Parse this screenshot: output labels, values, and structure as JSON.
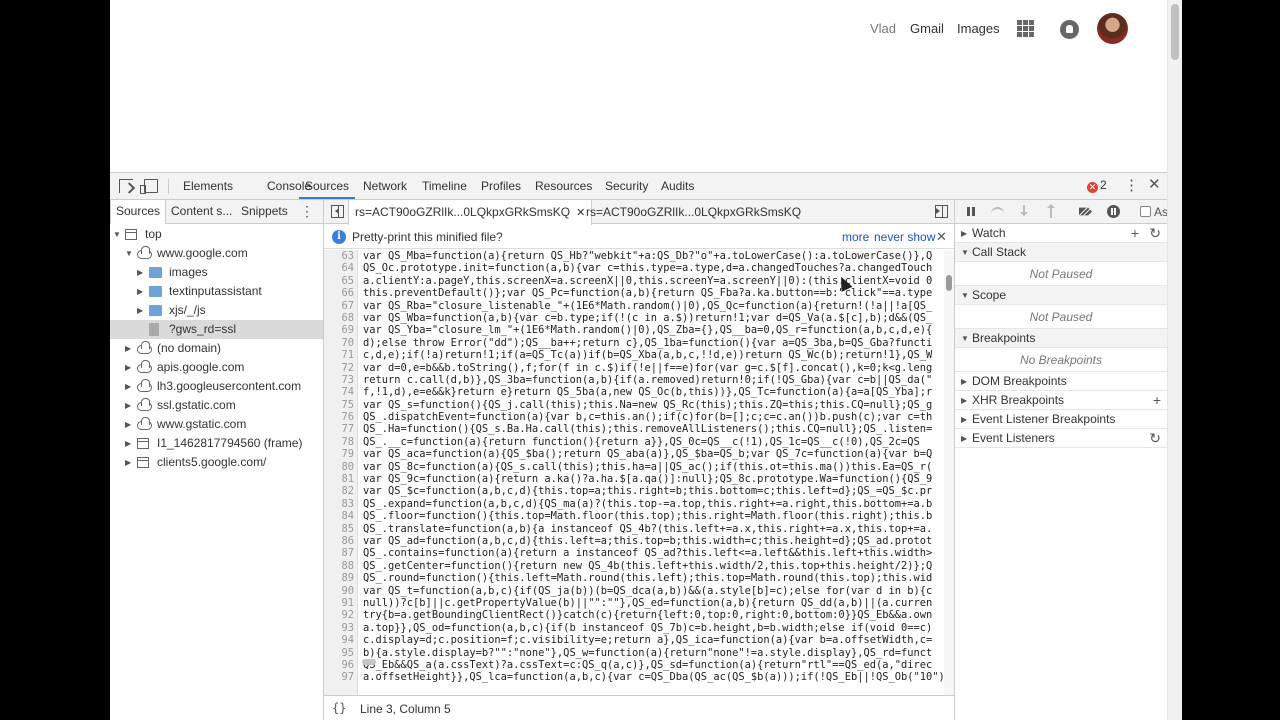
{
  "google_bar": {
    "user": "Vlad",
    "gmail": "Gmail",
    "images": "Images"
  },
  "devtools": {
    "tabs": [
      "Elements",
      "Console",
      "Sources",
      "Network",
      "Timeline",
      "Profiles",
      "Resources",
      "Security",
      "Audits"
    ],
    "active_tab": "Sources",
    "error_count": "2"
  },
  "navigator": {
    "tabs": [
      "Sources",
      "Content s...",
      "Snippets"
    ],
    "tree": [
      {
        "label": "top",
        "indent": 0,
        "arrow": "▼",
        "icon": "frame"
      },
      {
        "label": "www.google.com",
        "indent": 1,
        "arrow": "▼",
        "icon": "cloud"
      },
      {
        "label": "images",
        "indent": 2,
        "arrow": "▶",
        "icon": "folder"
      },
      {
        "label": "textinputassistant",
        "indent": 2,
        "arrow": "▶",
        "icon": "folder"
      },
      {
        "label": "xjs/_/js",
        "indent": 2,
        "arrow": "▶",
        "icon": "folder"
      },
      {
        "label": "?gws_rd=ssl",
        "indent": 2,
        "arrow": "",
        "icon": "file",
        "selected": true
      },
      {
        "label": "(no domain)",
        "indent": 1,
        "arrow": "▶",
        "icon": "cloud"
      },
      {
        "label": "apis.google.com",
        "indent": 1,
        "arrow": "▶",
        "icon": "cloud"
      },
      {
        "label": "lh3.googleusercontent.com",
        "indent": 1,
        "arrow": "▶",
        "icon": "cloud"
      },
      {
        "label": "ssl.gstatic.com",
        "indent": 1,
        "arrow": "▶",
        "icon": "cloud"
      },
      {
        "label": "www.gstatic.com",
        "indent": 1,
        "arrow": "▶",
        "icon": "cloud"
      },
      {
        "label": "I1_1462817794560 (frame)",
        "indent": 1,
        "arrow": "▶",
        "icon": "frame"
      },
      {
        "label": "clients5.google.com/",
        "indent": 1,
        "arrow": "▶",
        "icon": "frame"
      }
    ]
  },
  "editor": {
    "tabs": [
      "rs=ACT90oGZRlIk...0LQkpxGRkSmsKQ",
      "rs=ACT90oGZRlIk...0LQkpxGRkSmsKQ"
    ],
    "infobar": {
      "text": "Pretty-print this minified file?",
      "more": "more",
      "never_show": "never show"
    },
    "status": "Line 3, Column 5",
    "format_label": "{}",
    "lines": [
      {
        "n": "63",
        "t": "var QS_Mba=function(a){return QS_Hb?\"webkit\"+a:QS_Db?\"o\"+a.toLowerCase():a.toLowerCase()},Q"
      },
      {
        "n": "64",
        "t": "QS_Oc.prototype.init=function(a,b){var c=this.type=a.type,d=a.changedTouches?a.changedTouch"
      },
      {
        "n": "65",
        "t": "a.clientY:a.pageY,this.screenX=a.screenX||0,this.screenY=a.screenY||0):(this.clientX=void 0"
      },
      {
        "n": "66",
        "t": "this.preventDefault()};var QS_Pc=function(a,b){return QS_Fba?a.ka.button==b:\"click\"==a.type"
      },
      {
        "n": "67",
        "t": "var QS_Rba=\"closure_listenable_\"+(1E6*Math.random()|0),QS_Qc=function(a){return!(!a||!a[QS_"
      },
      {
        "n": "68",
        "t": "var QS_Wba=function(a,b){var c=b.type;if(!(c in a.$))return!1;var d=QS_Va(a.$[c],b);d&&(QS_"
      },
      {
        "n": "69",
        "t": "var QS_Yba=\"closure_lm_\"+(1E6*Math.random()|0),QS_Zba={},QS__ba=0,QS_r=function(a,b,c,d,e){"
      },
      {
        "n": "70",
        "t": "d);else throw Error(\"dd\");QS__ba++;return c},QS_1ba=function(){var a=QS_3ba,b=QS_Gba?functi"
      },
      {
        "n": "71",
        "t": "c,d,e);if(!a)return!1;if(a=QS_Tc(a))if(b=QS_Xba(a,b,c,!!d,e))return QS_Wc(b);return!1},QS_W"
      },
      {
        "n": "72",
        "t": "var d=0,e=b&&b.toString(),f;for(f in c.$)if(!e||f==e)for(var g=c.$[f].concat(),k=0;k<g.leng"
      },
      {
        "n": "73",
        "t": "return c.call(d,b)},QS_3ba=function(a,b){if(a.removed)return!0;if(!QS_Gba){var c=b||QS_da(\""
      },
      {
        "n": "74",
        "t": "f,!1,d),e=e&&k}return e}return QS_5ba(a,new QS_Oc(b,this))},QS_Tc=function(a){a=a[QS_Yba];r"
      },
      {
        "n": "75",
        "t": "var QS_s=function(){QS_j.call(this);this.Na=new QS_Rc(this);this.ZQ=this;this.CQ=null};QS_g"
      },
      {
        "n": "76",
        "t": "QS_.dispatchEvent=function(a){var b,c=this.an();if(c)for(b=[];c;c=c.an())b.push(c);var c=th"
      },
      {
        "n": "77",
        "t": "QS_.Ha=function(){QS_s.Ba.Ha.call(this);this.removeAllListeners();this.CQ=null};QS_.listen="
      },
      {
        "n": "78",
        "t": "QS_.__c=function(a){return function(){return a}},QS_0c=QS__c(!1),QS_1c=QS__c(!0),QS_2c=QS"
      },
      {
        "n": "79",
        "t": "var QS_aca=function(a){QS_$ba();return QS_aba(a)},QS_$ba=QS_b;var QS_7c=function(a){var b=Q"
      },
      {
        "n": "80",
        "t": "var QS_8c=function(a){QS_s.call(this);this.ha=a||QS_ac();if(this.ot=this.ma())this.Ea=QS_r("
      },
      {
        "n": "81",
        "t": "var QS_9c=function(a){return a.ka()?a.ha.$[a.qa()]:null};QS_8c.prototype.Wa=function(){QS_9"
      },
      {
        "n": "82",
        "t": "var QS_$c=function(a,b,c,d){this.top=a;this.right=b;this.bottom=c;this.left=d};QS_=QS_$c.pr"
      },
      {
        "n": "83",
        "t": "QS_.expand=function(a,b,c,d){QS_ma(a)?(this.top-=a.top,this.right+=a.right,this.bottom+=a.b"
      },
      {
        "n": "84",
        "t": "QS_.floor=function(){this.top=Math.floor(this.top);this.right=Math.floor(this.right);this.b"
      },
      {
        "n": "85",
        "t": "QS_.translate=function(a,b){a instanceof QS_4b?(this.left+=a.x,this.right+=a.x,this.top+=a."
      },
      {
        "n": "86",
        "t": "var QS_ad=function(a,b,c,d){this.left=a;this.top=b;this.width=c;this.height=d};QS_ad.protot"
      },
      {
        "n": "87",
        "t": "QS_.contains=function(a){return a instanceof QS_ad?this.left<=a.left&&this.left+this.width>"
      },
      {
        "n": "88",
        "t": "QS_.getCenter=function(){return new QS_4b(this.left+this.width/2,this.top+this.height/2)};Q"
      },
      {
        "n": "89",
        "t": "QS_.round=function(){this.left=Math.round(this.left);this.top=Math.round(this.top);this.wid"
      },
      {
        "n": "90",
        "t": "var QS_t=function(a,b,c){if(QS_ja(b))(b=QS_dca(a,b))&&(a.style[b]=c);else for(var d in b){c"
      },
      {
        "n": "91",
        "t": "null))?c[b]||c.getPropertyValue(b)||\"\":\"\"},QS_ed=function(a,b){return QS_dd(a,b)||(a.curren"
      },
      {
        "n": "92",
        "t": "try{b=a.getBoundingClientRect()}catch(c){return{left:0,top:0,right:0,bottom:0}}QS_Eb&&a.own"
      },
      {
        "n": "93",
        "t": "a.top}},QS_od=function(a,b,c){if(b instanceof QS_7b)c=b.height,b=b.width;else if(void 0==c)"
      },
      {
        "n": "94",
        "t": "c.display=d;c.position=f;c.visibility=e;return a},QS_ica=function(a){var b=a.offsetWidth,c="
      },
      {
        "n": "95",
        "t": "b){a.style.display=b?\"\":\"none\"},QS_w=function(a){return\"none\"!=a.style.display},QS_rd=funct"
      },
      {
        "n": "96",
        "t": "QS_Eb&&QS_a(a.cssText)?a.cssText=c:QS_q(a,c)},QS_sd=function(a){return\"rtl\"==QS_ed(a,\"direc"
      },
      {
        "n": "97",
        "t": "a.offsetHeight}},QS_lca=function(a,b,c){var c=QS_Dba(QS_ac(QS_$b(a)));if(!QS_Eb||!QS_Ob(\"10\"))"
      }
    ]
  },
  "debugger": {
    "async_label": "As",
    "panes": [
      {
        "label": "Watch",
        "expanded": false,
        "action": "+",
        "secondary_action": "↻"
      },
      {
        "label": "Call Stack",
        "expanded": true,
        "empty": "Not Paused"
      },
      {
        "label": "Scope",
        "expanded": true,
        "empty": "Not Paused"
      },
      {
        "label": "Breakpoints",
        "expanded": true,
        "empty": "No Breakpoints"
      },
      {
        "label": "DOM Breakpoints",
        "expanded": false
      },
      {
        "label": "XHR Breakpoints",
        "expanded": false,
        "action": "+"
      },
      {
        "label": "Event Listener Breakpoints",
        "expanded": false
      },
      {
        "label": "Event Listeners",
        "expanded": false,
        "action": "↻"
      }
    ]
  }
}
